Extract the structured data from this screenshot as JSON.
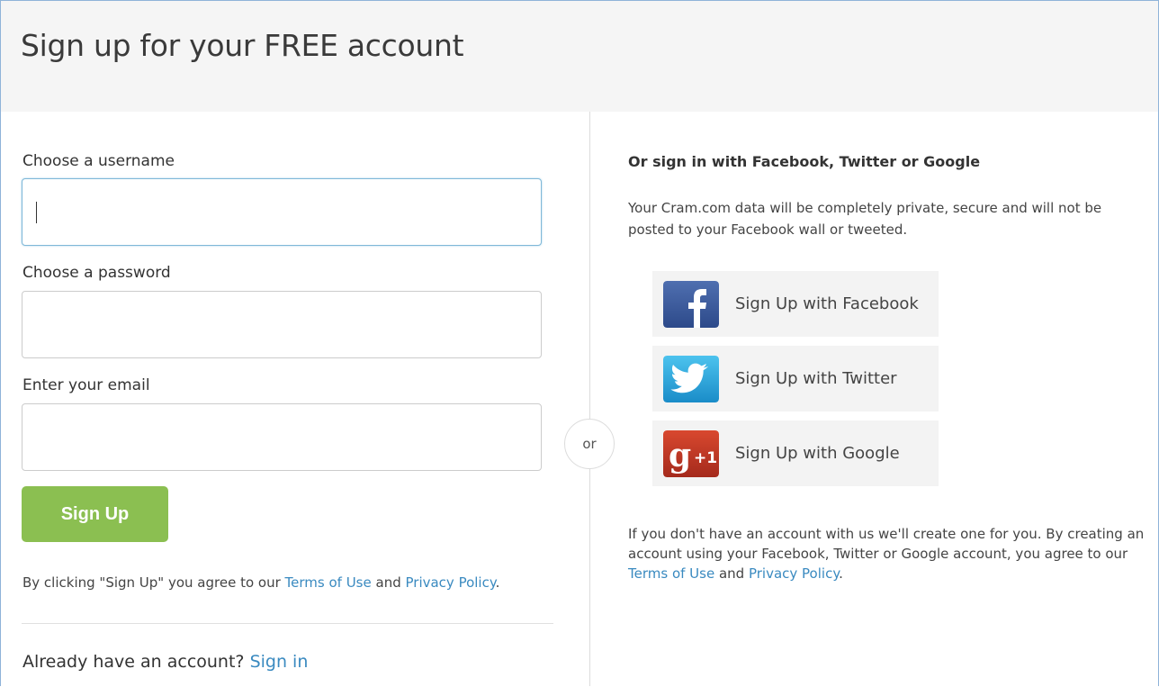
{
  "header": {
    "title": "Sign up for your FREE account"
  },
  "form": {
    "username_label": "Choose a username",
    "username_value": "",
    "password_label": "Choose a password",
    "password_value": "",
    "email_label": "Enter your email",
    "email_value": "",
    "signup_button": "Sign Up",
    "agree_prefix": "By clicking \"Sign Up\" you agree to our ",
    "agree_terms": "Terms of Use",
    "agree_and": " and ",
    "agree_privacy": "Privacy Policy",
    "agree_suffix": "."
  },
  "signin": {
    "prompt": "Already have an account? ",
    "link": "Sign in"
  },
  "separator": {
    "label": "or"
  },
  "social": {
    "title": "Or sign in with Facebook, Twitter or Google",
    "privacy_note": "Your Cram.com data will be completely private, secure and will not be posted to your Facebook wall or tweeted.",
    "buttons": [
      {
        "label": "Sign Up with Facebook",
        "icon": "facebook-icon",
        "color": "#3b5998"
      },
      {
        "label": "Sign Up with Twitter",
        "icon": "twitter-icon",
        "color": "#2aa3dc"
      },
      {
        "label": "Sign Up with Google",
        "icon": "google-plus-one-icon",
        "color": "#c0392b"
      }
    ],
    "note_prefix": "If you don't have an account with us we'll create one for you. By creating an account using your Facebook, Twitter or Google account, you agree to our ",
    "note_terms": "Terms of Use",
    "note_and": " and ",
    "note_privacy": "Privacy Policy",
    "note_suffix": "."
  },
  "colors": {
    "accent_green": "#8bbf51",
    "link_blue": "#3a8ac0",
    "header_bg": "#f5f5f5"
  }
}
